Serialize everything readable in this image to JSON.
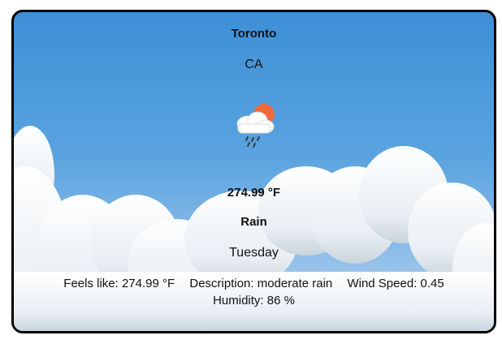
{
  "weather_card": {
    "city": "Toronto",
    "country": "CA",
    "icon": "rain-cloud-sun-icon",
    "temperature": "274.99 °F",
    "condition": "Rain",
    "day": "Tuesday",
    "details": {
      "feels_like": "Feels like: 274.99 °F",
      "description": "Description: moderate rain",
      "wind_speed": "Wind Speed: 0.45",
      "humidity": "Humidity: 86 %"
    }
  },
  "colors": {
    "sky_top": "#3d8fd6",
    "sun": "#f26a3c",
    "cloud": "#ffffff",
    "border": "#000000"
  }
}
